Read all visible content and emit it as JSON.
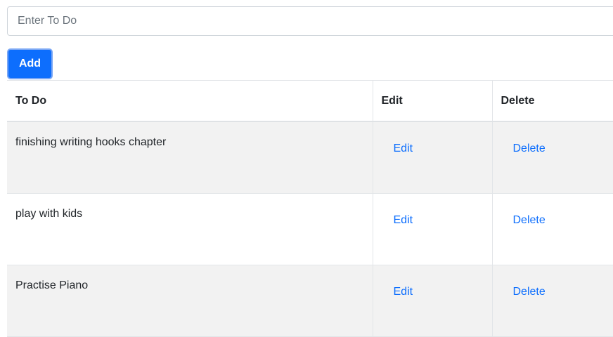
{
  "form": {
    "input_placeholder": "Enter To Do",
    "input_value": "",
    "add_label": "Add"
  },
  "table": {
    "headers": {
      "todo": "To Do",
      "edit": "Edit",
      "delete": "Delete"
    },
    "rows": [
      {
        "text": "finishing writing hooks chapter",
        "edit": "Edit",
        "delete": "Delete"
      },
      {
        "text": "play with kids",
        "edit": "Edit",
        "delete": "Delete"
      },
      {
        "text": "Practise Piano",
        "edit": "Edit",
        "delete": "Delete"
      }
    ]
  },
  "colors": {
    "primary": "#0d6efd",
    "stripe": "#f2f2f2",
    "border": "#e2e5e8"
  }
}
